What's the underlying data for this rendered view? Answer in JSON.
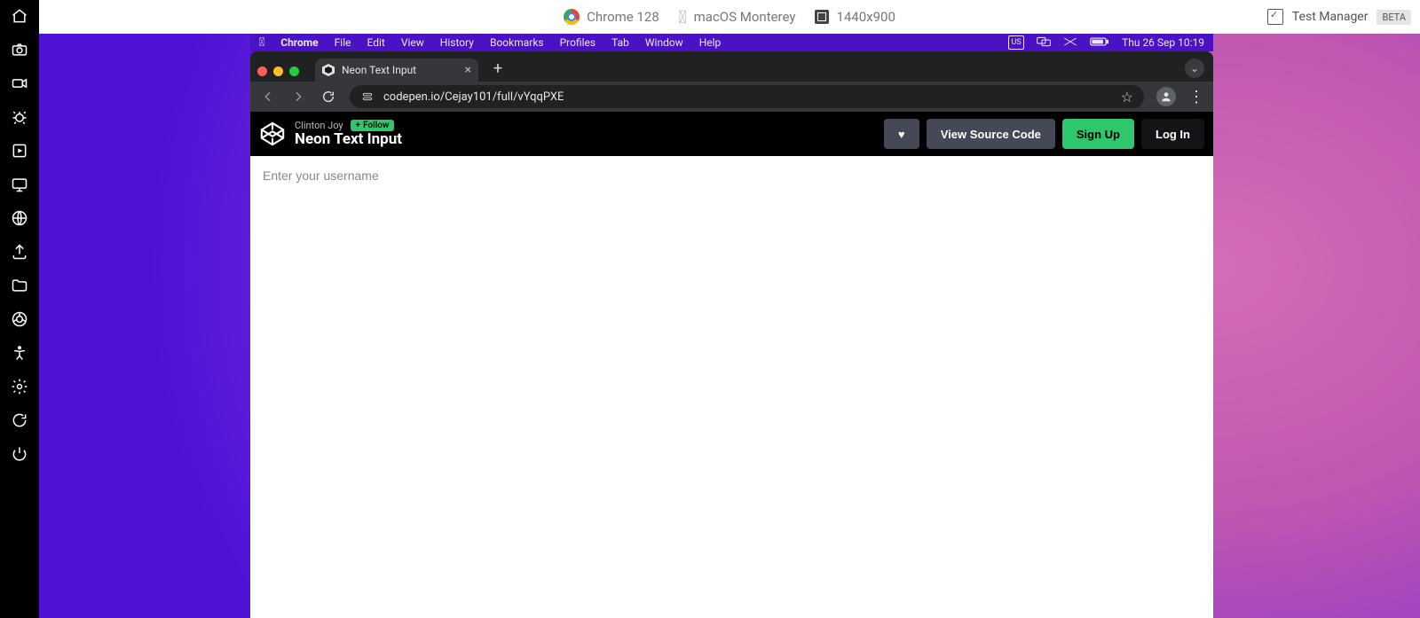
{
  "top_header": {
    "chrome_label": "Chrome 128",
    "os_label": "macOS Monterey",
    "resolution": "1440x900",
    "test_manager": "Test Manager",
    "beta": "BETA"
  },
  "mac_menu": {
    "app": "Chrome",
    "items": [
      "File",
      "Edit",
      "View",
      "History",
      "Bookmarks",
      "Profiles",
      "Tab",
      "Window",
      "Help"
    ],
    "input_indicator": "US",
    "datetime": "Thu 26 Sep  10:19"
  },
  "tabs": {
    "active_tab_title": "Neon Text Input"
  },
  "address_bar": {
    "url": "codepen.io/Cejay101/full/vYqqPXE"
  },
  "codepen": {
    "author": "Clinton Joy",
    "follow": "Follow",
    "title": "Neon Text Input",
    "view_source": "View Source Code",
    "sign_up": "Sign Up",
    "log_in": "Log In"
  },
  "page": {
    "username_placeholder": "Enter your username"
  }
}
